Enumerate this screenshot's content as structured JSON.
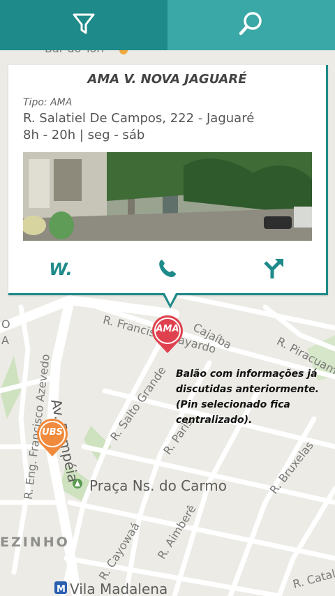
{
  "toolbar": {
    "filter_icon": "filter-funnel-icon",
    "search_icon": "search-magnifier-icon",
    "colors": {
      "filter_tab": "#1f8a8a",
      "search_tab": "#3aa8a6"
    }
  },
  "card": {
    "title": "AMA V. NOVA JAGUARÉ",
    "type_line": "Tipo: AMA",
    "address": "R. Salatiel De Campos, 222 - Jaguaré",
    "hours": "8h - 20h | seg - sáb",
    "photo": "street-view-photo",
    "actions": {
      "website_label": "W.",
      "phone_icon": "phone-icon",
      "directions_icon": "directions-icon"
    },
    "accent_color": "#1f8a8a"
  },
  "pins": {
    "selected": {
      "label": "AMA",
      "color": "#e0414f"
    },
    "other": {
      "label": "UBS",
      "color": "#f08a3c"
    }
  },
  "note": {
    "lines": [
      "Balão com informações já",
      "discutidas anteriormente.",
      "(Pin selecionado fica",
      "centralizado)."
    ]
  },
  "map": {
    "labels": {
      "bar": "Bar do Tori",
      "francisco": "R. Francisco Bayardo",
      "cajaiba": "Cajaíba",
      "piracuama": "R. Piracuama",
      "salto_grande": "R. Salto Grande",
      "paris": "R. Paris",
      "pompeia": "Av. Pompéia",
      "eng_francisco": "R. Eng. Francisco Azevedo",
      "praca": "Praça Ns. do Carmo",
      "bruxelas": "R. Bruxelas",
      "cayowaa": "R. Cayowaá",
      "aimbere": "R. Aimberê",
      "catalao": "R. Catal",
      "vila_madalena": "Vila Madalena",
      "zinho": "EZINHO",
      "left_a": "A",
      "left_o": "O"
    }
  }
}
